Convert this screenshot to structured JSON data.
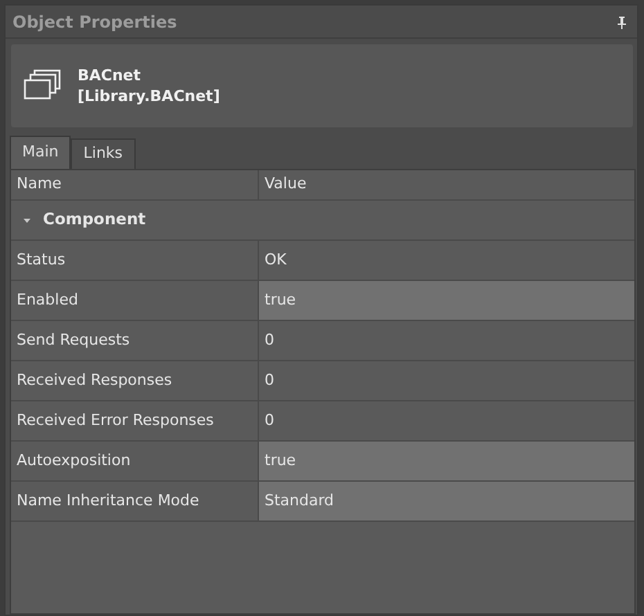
{
  "panel": {
    "title": "Object Properties"
  },
  "object": {
    "name": "BACnet",
    "type": "[Library.BACnet]"
  },
  "tabs": [
    {
      "label": "Main",
      "selected": true
    },
    {
      "label": "Links",
      "selected": false
    }
  ],
  "table": {
    "columns": [
      "Name",
      "Value"
    ],
    "group": {
      "label": "Component",
      "expanded": true
    },
    "rows": [
      {
        "name": "Status",
        "value": "OK",
        "editable": false
      },
      {
        "name": "Enabled",
        "value": "true",
        "editable": true
      },
      {
        "name": "Send Requests",
        "value": "0",
        "editable": false
      },
      {
        "name": "Received Responses",
        "value": "0",
        "editable": false
      },
      {
        "name": "Received Error Responses",
        "value": "0",
        "editable": false
      },
      {
        "name": "Autoexposition",
        "value": "true",
        "editable": true
      },
      {
        "name": "Name Inheritance Mode",
        "value": "Standard",
        "editable": true
      }
    ]
  }
}
